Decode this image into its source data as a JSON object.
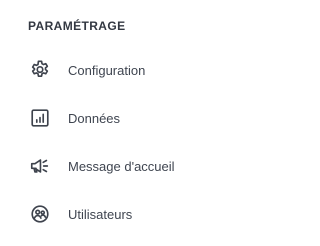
{
  "section": {
    "title": "PARAMÉTRAGE"
  },
  "menu": {
    "items": [
      {
        "label": "Configuration",
        "icon": "gear-icon"
      },
      {
        "label": "Données",
        "icon": "chart-icon"
      },
      {
        "label": "Message d'accueil",
        "icon": "megaphone-icon"
      },
      {
        "label": "Utilisateurs",
        "icon": "users-icon"
      }
    ]
  },
  "colors": {
    "text": "#3f4550",
    "icon": "#3e434d",
    "background": "#ffffff"
  }
}
